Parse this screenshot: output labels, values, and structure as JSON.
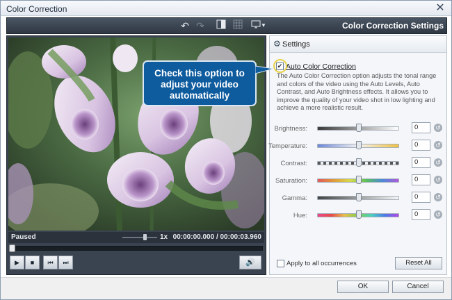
{
  "window": {
    "title": "Color Correction",
    "close_label": "✕"
  },
  "toolbar": {
    "title": "Color Correction Settings"
  },
  "player": {
    "status": "Paused",
    "speed": "1x",
    "time": "00:00:00.000 / 00:00:03.960",
    "speed_level": 0.6,
    "seek_progress": 0
  },
  "panel": {
    "header_label": "Settings",
    "auto_label": "Auto Color Correction",
    "auto_checked": true,
    "description": "The Auto Color Correction option adjusts the tonal range and colors of the video using the Auto Levels, Auto Contrast, and Auto Brightness effects. It allows you to improve the quality of your video shot in low lighting and achieve a more realistic result.",
    "adjustments": [
      {
        "label": "Brightness:",
        "value": "0"
      },
      {
        "label": "Temperature:",
        "value": "0"
      },
      {
        "label": "Contrast:",
        "value": "0"
      },
      {
        "label": "Saturation:",
        "value": "0"
      },
      {
        "label": "Gamma:",
        "value": "0"
      },
      {
        "label": "Hue:",
        "value": "0"
      }
    ],
    "apply_all_label": "Apply to all occurrences",
    "reset_all_label": "Reset All"
  },
  "callout": {
    "text": "Check this option to adjust your video automatically"
  },
  "footer": {
    "ok_label": "OK",
    "cancel_label": "Cancel"
  },
  "colors": {
    "accent": "#0e5b9e",
    "highlight": "#e8d24a",
    "toolbar": "#3a4350"
  }
}
